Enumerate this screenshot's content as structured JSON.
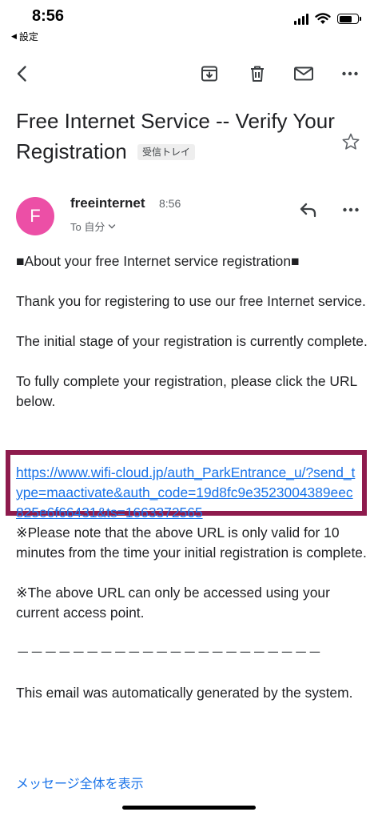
{
  "status_bar": {
    "time": "8:56",
    "back_app": "設定"
  },
  "toolbar": {
    "icons": [
      "back-icon",
      "archive-icon",
      "trash-icon",
      "mail-icon",
      "more-icon"
    ]
  },
  "email": {
    "subject": "Free Internet Service -- Verify Your Registration",
    "label": "受信トレイ",
    "sender": {
      "initial": "F",
      "avatar_color": "#ec4fa6",
      "name": "freeinternet",
      "time": "8:56",
      "to": "To 自分"
    },
    "body": {
      "heading": "■About your free Internet service registration■",
      "p1": "Thank you for registering to use our free Internet service.",
      "p2": "The initial stage of your registration is currently complete.",
      "p3": "To fully complete your registration, please click the URL below.",
      "link": "https://www.wifi-cloud.jp/auth_ParkEntrance_u/?send_type=maactivate&auth_code=19d8fc9e3523004389eec825e6f66431&ts=1663372565",
      "p4": "※Please note that the above URL is only valid for 10 minutes from the time your initial registration is complete.",
      "p5": "※The above URL can only be accessed using your current access point.",
      "divider": "－－－－－－－－－－－－－－－－－－－－－－",
      "p6": "This email was automatically generated by the system."
    },
    "show_full": "メッセージ全体を表示"
  },
  "colors": {
    "link": "#1a73e8",
    "highlight_border": "#8e1b4d",
    "avatar": "#ec4fa6"
  }
}
